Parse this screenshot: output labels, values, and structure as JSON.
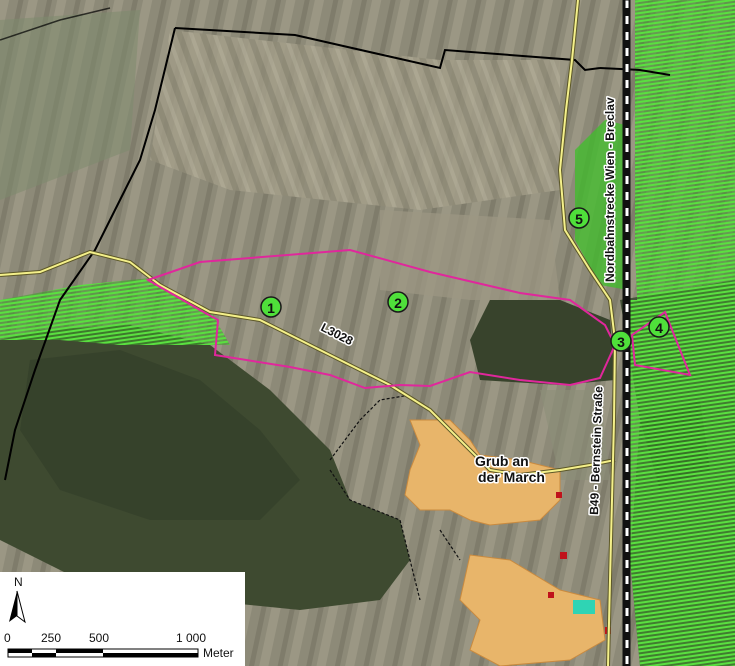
{
  "map": {
    "places": [
      {
        "id": "village",
        "line1": "Grub an",
        "line2": "der March"
      }
    ],
    "roads": [
      {
        "id": "l3028",
        "label": "L3028"
      },
      {
        "id": "b49",
        "label": "B49 - Bernstein Straße"
      }
    ],
    "railway": {
      "label": "Nordbahnstrecke Wien - Breclav"
    },
    "markers": [
      {
        "id": "m1",
        "label": "1"
      },
      {
        "id": "m2",
        "label": "2"
      },
      {
        "id": "m3",
        "label": "3"
      },
      {
        "id": "m4",
        "label": "4"
      },
      {
        "id": "m5",
        "label": "5"
      }
    ],
    "north_arrow": {
      "label": "N"
    },
    "scale_bar": {
      "ticks": [
        "0",
        "250",
        "500",
        "1 000"
      ],
      "unit": "Meter"
    },
    "colors": {
      "study_area": "#e0279c",
      "protected_area": "#3fbf2a",
      "boundary": "#000000",
      "road": "#f4f08a",
      "settlement": "#e8b56a",
      "forest": "#3f4a30",
      "marker_fill": "#4fe03a"
    }
  }
}
